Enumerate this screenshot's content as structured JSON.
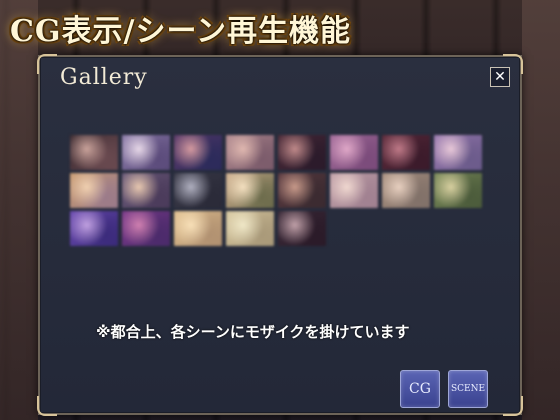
{
  "banner": {
    "text": "CG表示/シーン再生機能"
  },
  "gallery": {
    "title": "Gallery",
    "close_label": "✕",
    "notice": "※都合上、各シーンにモザイクを掛けています",
    "buttons": {
      "cg": "CG",
      "scene": "SCENE"
    },
    "thumbnails": [
      {
        "colors": [
          "#3a2a30",
          "#c9a29a",
          "#6a4a50"
        ]
      },
      {
        "colors": [
          "#8a7aa8",
          "#e7d8e8",
          "#5a4a7a"
        ]
      },
      {
        "colors": [
          "#5a3a6a",
          "#d59aa0",
          "#2a2a5a"
        ]
      },
      {
        "colors": [
          "#b08a90",
          "#e0b8b0",
          "#7a5a6a"
        ]
      },
      {
        "colors": [
          "#4a2a38",
          "#c08a8a",
          "#2a1a2a"
        ]
      },
      {
        "colors": [
          "#a06a98",
          "#e0a8c8",
          "#7a4a7a"
        ]
      },
      {
        "colors": [
          "#5a2a3a",
          "#c07a88",
          "#3a1a2a"
        ]
      },
      {
        "colors": [
          "#9a7ab0",
          "#e8c8d8",
          "#6a5a8a"
        ]
      },
      {
        "colors": [
          "#c89a70",
          "#f0d0b0",
          "#9a7a8a"
        ]
      },
      {
        "colors": [
          "#6a5a7a",
          "#e8c8b0",
          "#4a3a5a"
        ]
      },
      {
        "colors": [
          "#3a3a48",
          "#b0b0c0",
          "#2a2a38"
        ]
      },
      {
        "colors": [
          "#d0b090",
          "#f4e0c0",
          "#6a6a4a"
        ]
      },
      {
        "colors": [
          "#5a3a40",
          "#c89a8a",
          "#3a2a30"
        ]
      },
      {
        "colors": [
          "#c0a0a8",
          "#f0d8d0",
          "#a08090"
        ]
      },
      {
        "colors": [
          "#a89080",
          "#e8d0c0",
          "#807068"
        ]
      },
      {
        "colors": [
          "#7a8a5a",
          "#d8d0a0",
          "#4a5a3a"
        ]
      },
      {
        "colors": [
          "#6a4ab0",
          "#c0a0e0",
          "#3a2a7a"
        ]
      },
      {
        "colors": [
          "#7a3a8a",
          "#d080b0",
          "#4a2a6a"
        ]
      },
      {
        "colors": [
          "#e0c090",
          "#f8e0b8",
          "#b09070"
        ]
      },
      {
        "colors": [
          "#d8c8a0",
          "#f0e8c8",
          "#a89878"
        ]
      },
      {
        "colors": [
          "#3a2a38",
          "#c0a0a8",
          "#2a1a28"
        ]
      }
    ]
  }
}
